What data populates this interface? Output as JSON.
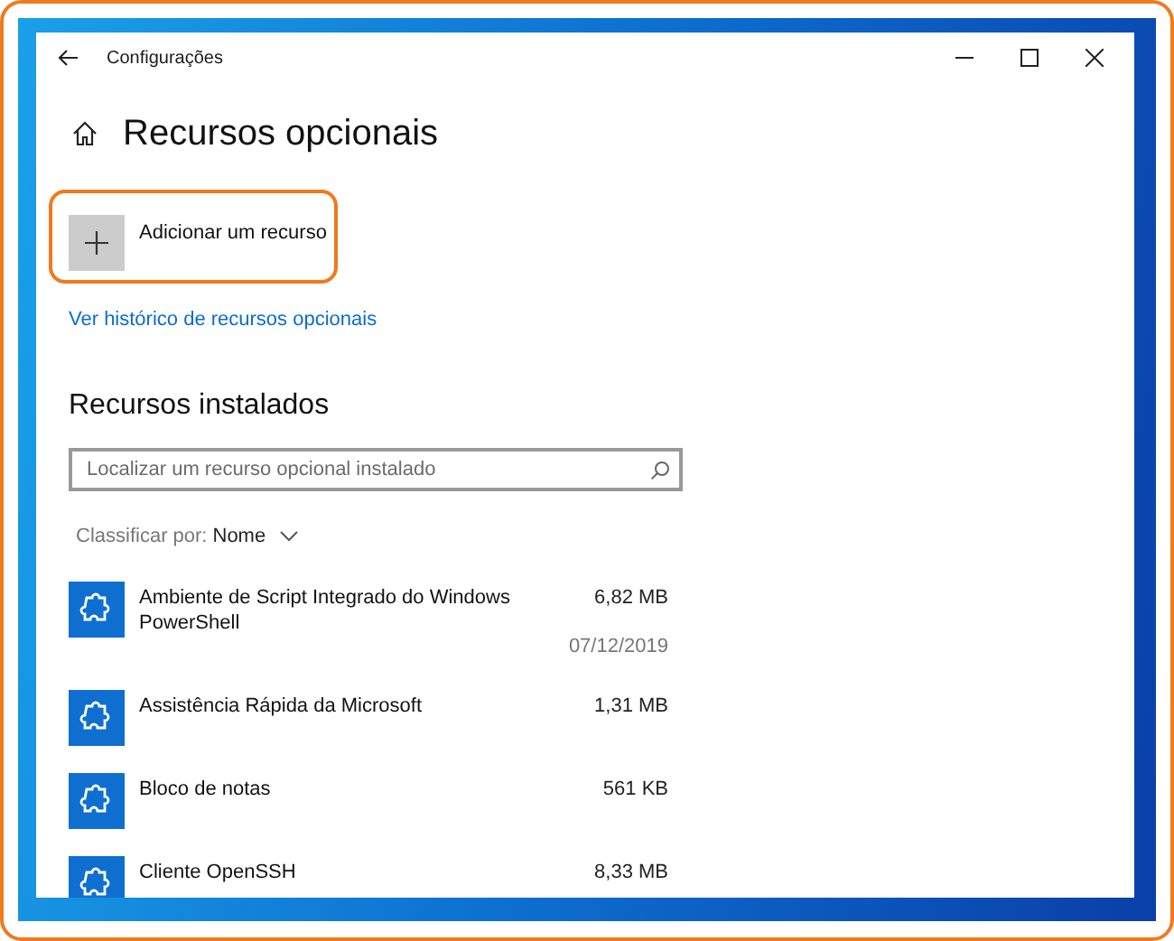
{
  "window": {
    "title": "Configurações"
  },
  "page": {
    "title": "Recursos opcionais"
  },
  "add_button": {
    "label": "Adicionar um recurso",
    "highlighted": true
  },
  "history_link": "Ver histórico de recursos opcionais",
  "installed": {
    "heading": "Recursos instalados",
    "search": {
      "placeholder": "Localizar um recurso opcional instalado"
    },
    "sort": {
      "label": "Classificar por:",
      "value": "Nome"
    },
    "items": [
      {
        "name": "Ambiente de Script Integrado do Windows PowerShell",
        "size": "6,82 MB",
        "date": "07/12/2019"
      },
      {
        "name": "Assistência Rápida da Microsoft",
        "size": "1,31 MB"
      },
      {
        "name": "Bloco de notas",
        "size": "561 KB"
      },
      {
        "name": "Cliente OpenSSH",
        "size": "8,33 MB"
      }
    ]
  }
}
